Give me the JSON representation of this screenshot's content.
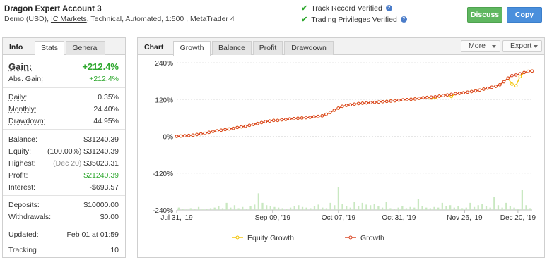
{
  "header": {
    "title": "Dragon Expert Account 3",
    "sub_prefix": "Demo (USD),",
    "broker": "IC Markets",
    "sub_suffix": ", Technical, Automated, 1:500 , MetaTrader 4",
    "track_record": "Track Record Verified",
    "trading_privileges": "Trading Privileges Verified",
    "discuss_label": "Discuss",
    "copy_label": "Copy",
    "help_glyph": "?",
    "check_glyph": "✔"
  },
  "info": {
    "section_label": "Info",
    "tabs": [
      "Stats",
      "General"
    ],
    "gain": {
      "label": "Gain:",
      "value": "+212.4%"
    },
    "abs_gain": {
      "label": "Abs. Gain:",
      "value": "+212.4%"
    },
    "daily": {
      "label": "Daily:",
      "value": "0.35%"
    },
    "monthly": {
      "label": "Monthly:",
      "value": "24.40%"
    },
    "drawdown": {
      "label": "Drawdown:",
      "value": "44.95%"
    },
    "balance": {
      "label": "Balance:",
      "value": "$31240.39"
    },
    "equity": {
      "label": "Equity:",
      "note": "(100.00%)",
      "value": "$31240.39"
    },
    "highest": {
      "label": "Highest:",
      "note": "(Dec 20)",
      "value": "$35023.31"
    },
    "profit": {
      "label": "Profit:",
      "value": "$21240.39"
    },
    "interest": {
      "label": "Interest:",
      "value": "-$693.57"
    },
    "deposits": {
      "label": "Deposits:",
      "value": "$10000.00"
    },
    "withdrawals": {
      "label": "Withdrawals:",
      "value": "$0.00"
    },
    "updated": {
      "label": "Updated:",
      "value": "Feb 01 at 01:59"
    },
    "tracking": {
      "label": "Tracking",
      "value": "10"
    }
  },
  "chart_panel": {
    "section_label": "Chart",
    "tabs": [
      "Growth",
      "Balance",
      "Profit",
      "Drawdown"
    ],
    "more_label": "More",
    "export_label": "Export"
  },
  "chart_data": {
    "type": "line",
    "y_ticks": [
      "240%",
      "120%",
      "0%",
      "-120%",
      "-240%"
    ],
    "y_tick_values": [
      240,
      120,
      0,
      -120,
      -240
    ],
    "ylim": [
      -240,
      240
    ],
    "x_ticks": [
      "Jul 31, '19",
      "Sep 09, '19",
      "Oct 07, '19",
      "Oct 31, '19",
      "Nov 26, '19",
      "Dec 20, '19"
    ],
    "x_tick_positions": [
      0,
      0.27,
      0.455,
      0.625,
      0.81,
      0.96
    ],
    "colors": {
      "growth": "#d9411e",
      "equity": "#f2c200",
      "bars": "#c9e8c1"
    },
    "legend": [
      "Equity Growth",
      "Growth"
    ],
    "series": [
      {
        "name": "Growth",
        "values": [
          0,
          1,
          2,
          3,
          4,
          6,
          8,
          10,
          13,
          16,
          18,
          20,
          22,
          24,
          26,
          29,
          31,
          33,
          36,
          39,
          42,
          45,
          48,
          50,
          52,
          52,
          54,
          55,
          57,
          58,
          59,
          60,
          61,
          62,
          64,
          65,
          67,
          72,
          78,
          85,
          92,
          98,
          101,
          103,
          105,
          107,
          108,
          109,
          110,
          111,
          112,
          113,
          114,
          115,
          116,
          118,
          119,
          120,
          121,
          122,
          124,
          126,
          127,
          128,
          129,
          131,
          133,
          135,
          137,
          139,
          140,
          142,
          144,
          146,
          148,
          151,
          154,
          157,
          160,
          163,
          168,
          178,
          190,
          198,
          200,
          204,
          208,
          212,
          213
        ]
      },
      {
        "name": "Equity Growth",
        "values": [
          0,
          1,
          2,
          3,
          4,
          6,
          8,
          10,
          13,
          16,
          18,
          20,
          22,
          24,
          26,
          29,
          31,
          33,
          36,
          39,
          42,
          45,
          48,
          50,
          52,
          52,
          54,
          55,
          57,
          58,
          59,
          60,
          61,
          62,
          64,
          65,
          67,
          72,
          78,
          85,
          92,
          98,
          101,
          103,
          105,
          107,
          108,
          109,
          110,
          111,
          112,
          113,
          114,
          115,
          116,
          118,
          119,
          120,
          121,
          122,
          124,
          126,
          127,
          125,
          126,
          131,
          133,
          135,
          130,
          139,
          140,
          142,
          144,
          146,
          148,
          151,
          154,
          157,
          160,
          163,
          168,
          178,
          190,
          170,
          165,
          195,
          208,
          212,
          213
        ]
      }
    ],
    "bar_values": [
      4,
      2,
      1,
      3,
      2,
      5,
      1,
      2,
      3,
      4,
      6,
      3,
      12,
      4,
      8,
      3,
      5,
      2,
      6,
      9,
      28,
      12,
      8,
      6,
      5,
      4,
      3,
      2,
      4,
      6,
      8,
      5,
      4,
      3,
      6,
      9,
      4,
      3,
      12,
      8,
      38,
      10,
      6,
      4,
      14,
      6,
      12,
      9,
      8,
      10,
      6,
      4,
      14,
      3,
      2,
      4,
      6,
      3,
      5,
      4,
      18,
      6,
      4,
      3,
      5,
      4,
      12,
      6,
      8,
      4,
      6,
      3,
      4,
      12,
      5,
      8,
      10,
      6,
      4,
      22,
      8,
      4,
      12,
      6,
      4,
      2,
      34,
      8,
      3
    ]
  }
}
